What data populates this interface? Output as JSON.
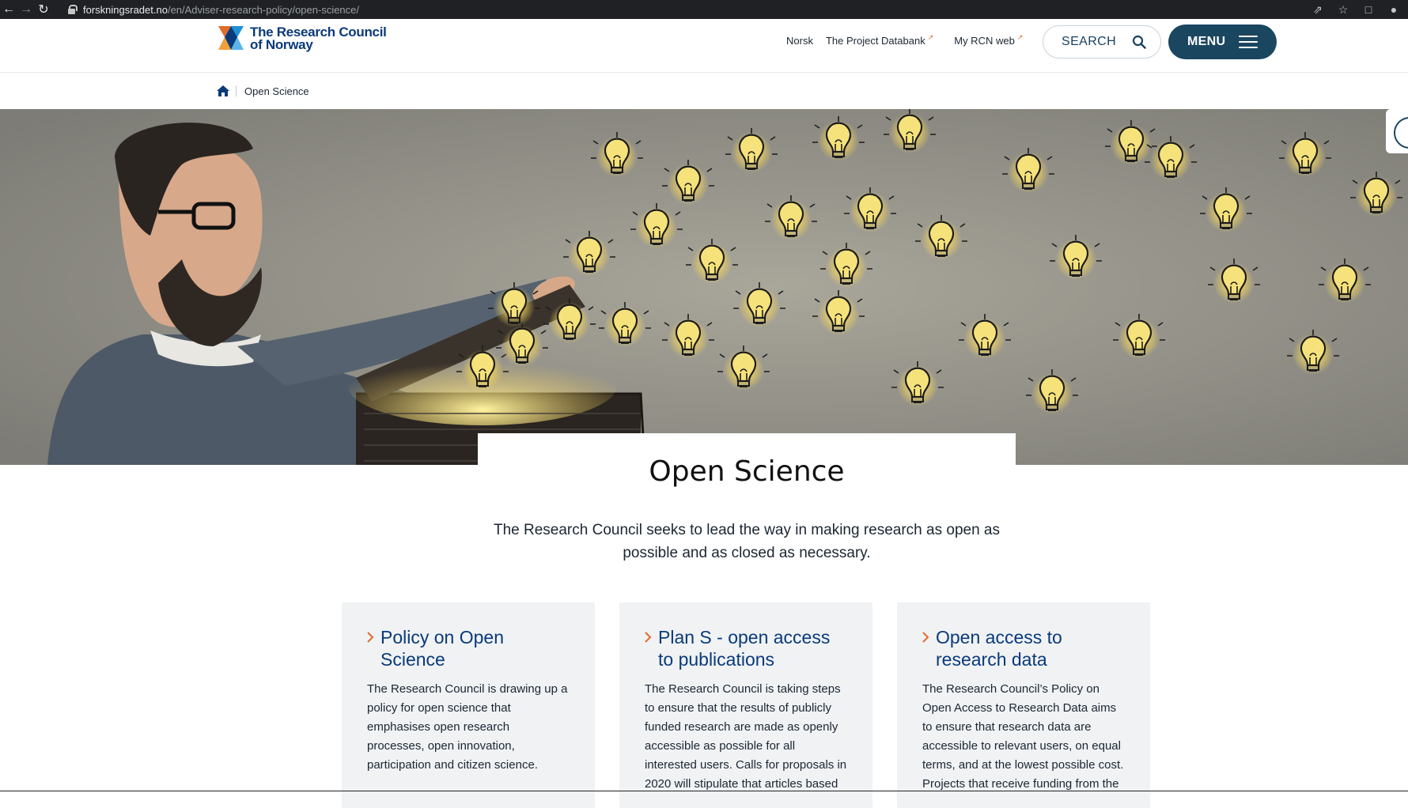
{
  "browser": {
    "url_domain": "forskningsradet.no",
    "url_path": "/en/Adviser-research-policy/open-science/"
  },
  "header": {
    "logo_line1": "The Research Council",
    "logo_line2": "of Norway",
    "links": [
      {
        "label": "Norsk",
        "external": false
      },
      {
        "label": "The Project Databank",
        "external": true
      },
      {
        "label": "My RCN web",
        "external": true
      }
    ],
    "search_label": "SEARCH",
    "menu_label": "MENU"
  },
  "breadcrumb": {
    "current": "Open Science"
  },
  "page": {
    "title": "Open Science",
    "lead": "The Research Council seeks to lead the way in making research as open as possible and as closed as necessary."
  },
  "cards": [
    {
      "title": "Policy on Open Science",
      "text": "The Research Council is drawing up a policy for open science that emphasises open research processes, open innovation, participation and citizen science."
    },
    {
      "title": "Plan S - open access to publications",
      "text": "The Research Council is taking steps to ensure that the results of publicly funded research are made as openly accessible as possible for all interested users. Calls for proposals in 2020 will stipulate that articles based"
    },
    {
      "title": "Open access to research data",
      "text": "The Research Council’s Policy on Open Access to Research Data aims to ensure that research data are accessible to relevant users, on equal terms, and at the lowest possible cost. Projects that receive funding from the"
    }
  ],
  "colors": {
    "brand_blue": "#0a3a7a",
    "menu_bg": "#1a4660",
    "accent_orange": "#e06b2a",
    "card_bg": "#f0f2f4"
  }
}
